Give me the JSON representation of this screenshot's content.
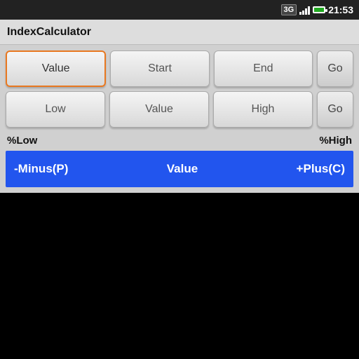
{
  "statusBar": {
    "time": "21:53",
    "networkType": "3G",
    "batteryIcon": "battery"
  },
  "titleBar": {
    "title": "IndexCalculator"
  },
  "row1": {
    "btn1": "Value",
    "btn2": "Start",
    "btn3": "End",
    "btn4": "Go"
  },
  "row2": {
    "btn1": "Low",
    "btn2": "Value",
    "btn3": "High",
    "btn4": "Go"
  },
  "percentRow": {
    "left": "%Low",
    "right": "%High"
  },
  "resultRow": {
    "minus": "-Minus(P)",
    "value": "Value",
    "plus": "+Plus(C)"
  }
}
